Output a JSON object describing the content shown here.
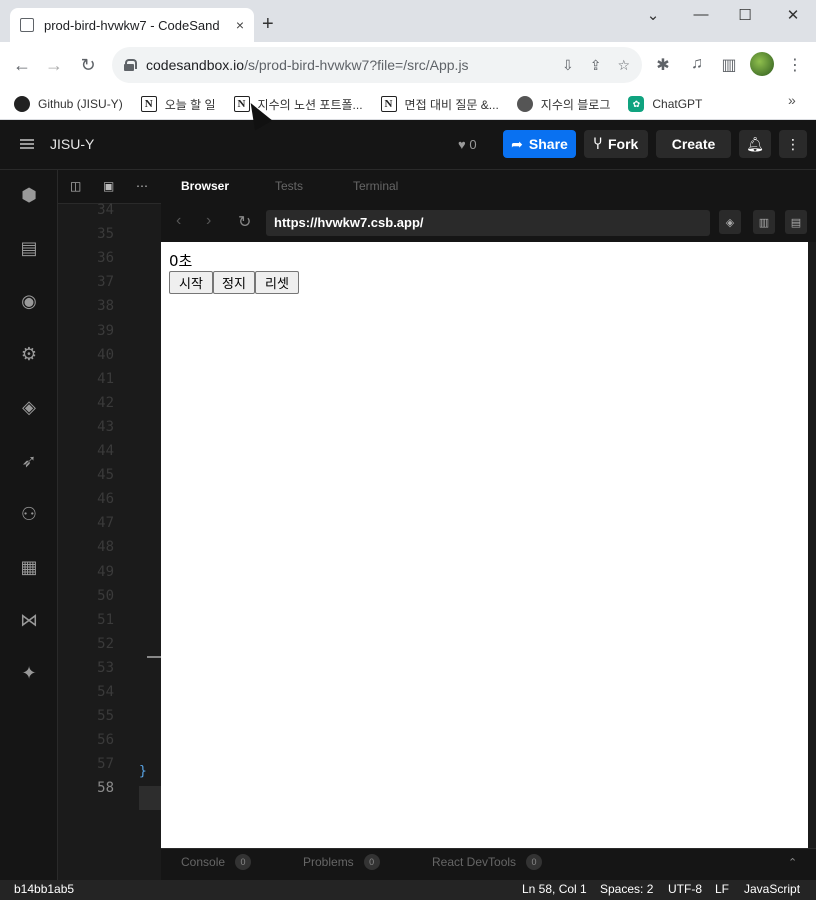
{
  "browser": {
    "tab_title": "prod-bird-hvwkw7 - CodeSand",
    "tab_close": "×",
    "new_tab": "+",
    "window_controls": [
      "⌄",
      "—",
      "☐",
      "✕"
    ],
    "url_host": "codesandbox.io",
    "url_path": "/s/prod-bird-hvwkw7?file=/src/App.js",
    "bookmarks": [
      {
        "label": "Github (JISU-Y)",
        "icon": "github-icon",
        "glyph": ""
      },
      {
        "label": "오늘 할 일",
        "icon": "notion-icon",
        "glyph": "N"
      },
      {
        "label": "지수의 노션 포트폴...",
        "icon": "notion-icon",
        "glyph": "N"
      },
      {
        "label": "면접 대비 질문 &...",
        "icon": "notion-icon",
        "glyph": "N"
      },
      {
        "label": "지수의 블로그",
        "icon": "globe-icon",
        "glyph": ""
      },
      {
        "label": "ChatGPT",
        "icon": "chatgpt-icon",
        "glyph": ""
      }
    ],
    "bookmarks_more": "»"
  },
  "csb": {
    "user": "JISU-Y",
    "likes": "0",
    "share_label": "Share",
    "fork_label": "Fork",
    "create_label": "Create"
  },
  "editor": {
    "line_numbers": [
      "34",
      "35",
      "36",
      "37",
      "38",
      "39",
      "40",
      "41",
      "42",
      "43",
      "44",
      "45",
      "46",
      "47",
      "48",
      "49",
      "50",
      "51",
      "52",
      "53",
      "54",
      "55",
      "56",
      "57",
      "58"
    ],
    "active_line": "58",
    "closing_brace": "}"
  },
  "preview": {
    "tabs": [
      "Browser",
      "Tests",
      "Terminal"
    ],
    "active_tab": "Browser",
    "url": "https://hvwkw7.csb.app/",
    "timer_text": "0초",
    "buttons": [
      "시작",
      "정지",
      "리셋"
    ]
  },
  "console": {
    "tabs": [
      {
        "label": "Console",
        "count": "0"
      },
      {
        "label": "Problems",
        "count": "0"
      },
      {
        "label": "React DevTools",
        "count": "0"
      }
    ]
  },
  "status": {
    "commit": "b14bb1ab5",
    "position": "Ln 58, Col 1",
    "spaces": "Spaces: 2",
    "encoding": "UTF-8",
    "eol": "LF",
    "language": "JavaScript"
  }
}
